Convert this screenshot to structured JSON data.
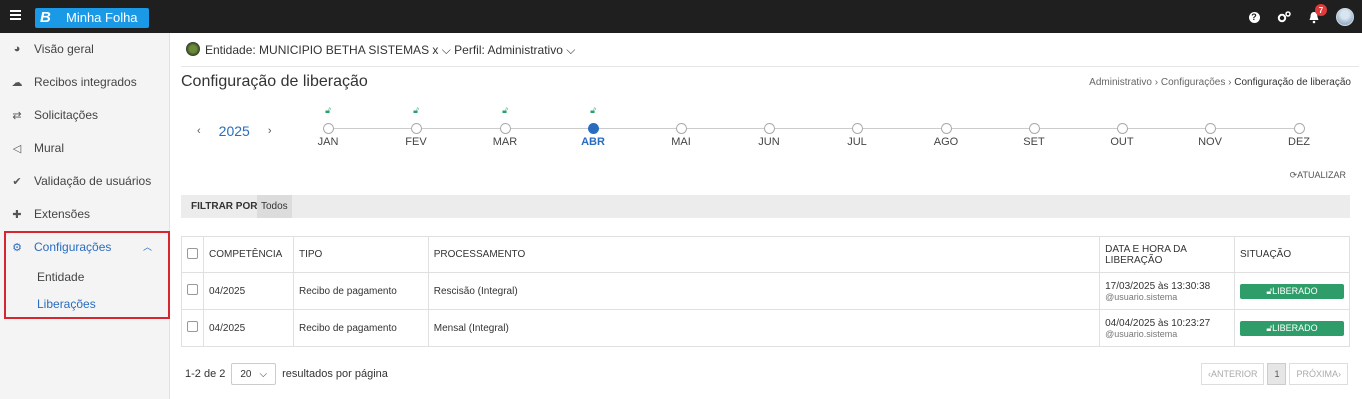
{
  "app": {
    "logo_letter": "B",
    "name": "Minha Folha",
    "notification_count": "7",
    "help_glyph": "?"
  },
  "sidebar": {
    "items": [
      {
        "label": "Visão geral",
        "icon": "pie-chart-icon"
      },
      {
        "label": "Recibos integrados",
        "icon": "cloud-download-icon"
      },
      {
        "label": "Solicitações",
        "icon": "exchange-icon"
      },
      {
        "label": "Mural",
        "icon": "megaphone-icon"
      },
      {
        "label": "Validação de usuários",
        "icon": "check-icon"
      },
      {
        "label": "Extensões",
        "icon": "puzzle-icon"
      },
      {
        "label": "Configurações",
        "icon": "gears-icon"
      }
    ],
    "sub_items": [
      {
        "label": "Entidade"
      },
      {
        "label": "Liberações"
      }
    ]
  },
  "context": {
    "text": "Entidade: MUNICIPIO BETHA SISTEMAS x ⌵  Perfil: Administrativo ⌵"
  },
  "page": {
    "title": "Configuração de liberação",
    "breadcrumb": [
      "Administrativo",
      "Configurações",
      "Configuração de liberação"
    ]
  },
  "timeline": {
    "year": "2025",
    "months": [
      {
        "label": "JAN",
        "unlocked": true
      },
      {
        "label": "FEV",
        "unlocked": true
      },
      {
        "label": "MAR",
        "unlocked": true
      },
      {
        "label": "ABR",
        "unlocked": true,
        "current": true
      },
      {
        "label": "MAI",
        "unlocked": false
      },
      {
        "label": "JUN",
        "unlocked": false
      },
      {
        "label": "JUL",
        "unlocked": false
      },
      {
        "label": "AGO",
        "unlocked": false
      },
      {
        "label": "SET",
        "unlocked": false
      },
      {
        "label": "OUT",
        "unlocked": false
      },
      {
        "label": "NOV",
        "unlocked": false
      },
      {
        "label": "DEZ",
        "unlocked": false
      }
    ],
    "refresh_label": "ATUALIZAR"
  },
  "filter": {
    "label": "FILTRAR POR",
    "value": "Todos"
  },
  "table": {
    "headers": [
      "COMPETÊNCIA",
      "TIPO",
      "PROCESSAMENTO",
      "DATA E HORA DA LIBERAÇÃO",
      "SITUAÇÃO"
    ],
    "rows": [
      {
        "competencia": "04/2025",
        "tipo": "Recibo de pagamento",
        "processamento": "Rescisão (Integral)",
        "data": "17/03/2025 às 13:30:38",
        "usuario": "@usuario.sistema",
        "situacao": "LIBERADO"
      },
      {
        "competencia": "04/2025",
        "tipo": "Recibo de pagamento",
        "processamento": "Mensal (Integral)",
        "data": "04/04/2025 às 10:23:27",
        "usuario": "@usuario.sistema",
        "situacao": "LIBERADO"
      }
    ]
  },
  "pagination": {
    "range": "1-2 de 2",
    "page_size": "20",
    "per_page_label": "resultados por página",
    "prev": "ANTERIOR",
    "page": "1",
    "next": "PRÓXIMA"
  },
  "colors": {
    "accent": "#2a6cc0",
    "success": "#2e9d6a",
    "brand": "#1a9ae6",
    "topbar": "#1f1f1f",
    "highlight": "#d6262f"
  }
}
